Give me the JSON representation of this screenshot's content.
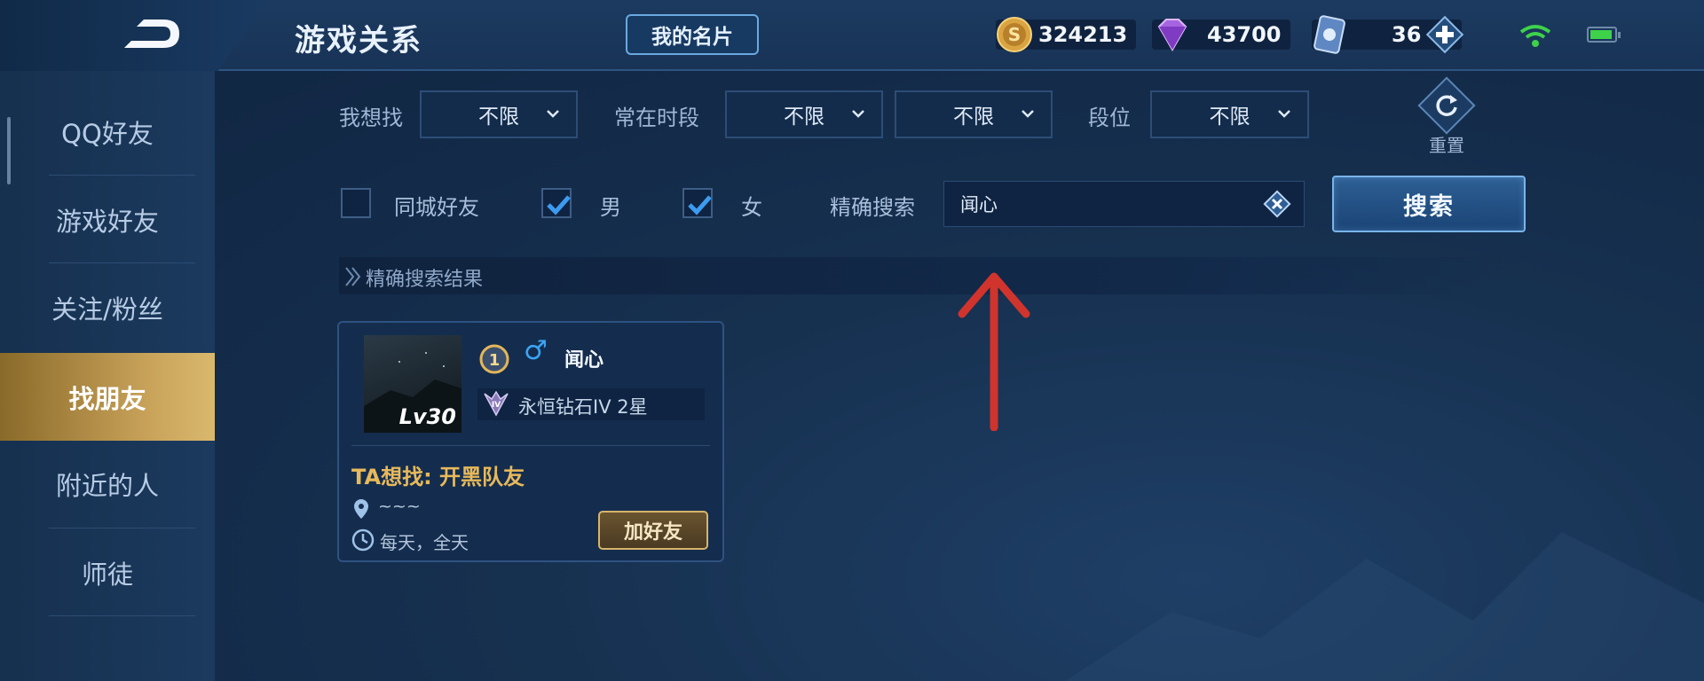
{
  "header": {
    "title": "游戏关系",
    "card_button": "我的名片",
    "gold": "324213",
    "diamond": "43700",
    "tickets": "36"
  },
  "sidebar": {
    "items": [
      {
        "label": "QQ好友"
      },
      {
        "label": "游戏好友"
      },
      {
        "label": "关注/粉丝"
      },
      {
        "label": "找朋友"
      },
      {
        "label": "附近的人"
      },
      {
        "label": "师徒"
      }
    ],
    "active_index": 3
  },
  "filters": {
    "looking_for_label": "我想找",
    "looking_for_value": "不限",
    "time_label": "常在时段",
    "time_value_1": "不限",
    "time_value_2": "不限",
    "rank_label": "段位",
    "rank_value": "不限",
    "reset_label": "重置"
  },
  "options": {
    "same_city_label": "同城好友",
    "same_city_checked": false,
    "male_label": "男",
    "male_checked": true,
    "female_label": "女",
    "female_checked": true,
    "exact_search_label": "精确搜索",
    "search_value": "闻心",
    "search_button": "搜索"
  },
  "results": {
    "section_title": "精确搜索结果",
    "player": {
      "level": "Lv30",
      "rank_num": "1",
      "gender_symbol": "♂",
      "name": "闻心",
      "rank_text": "永恒钻石IV 2星",
      "rank_icon_text": "IV",
      "wants_label": "TA想找",
      "wants_value": "开黑队友",
      "location": "~~~",
      "schedule": "每天，全天",
      "add_button": "加好友"
    }
  },
  "colors": {
    "accent_gold": "#e8b95b",
    "active_tab": "#c9a35a",
    "annotation_red": "#d0342c"
  }
}
